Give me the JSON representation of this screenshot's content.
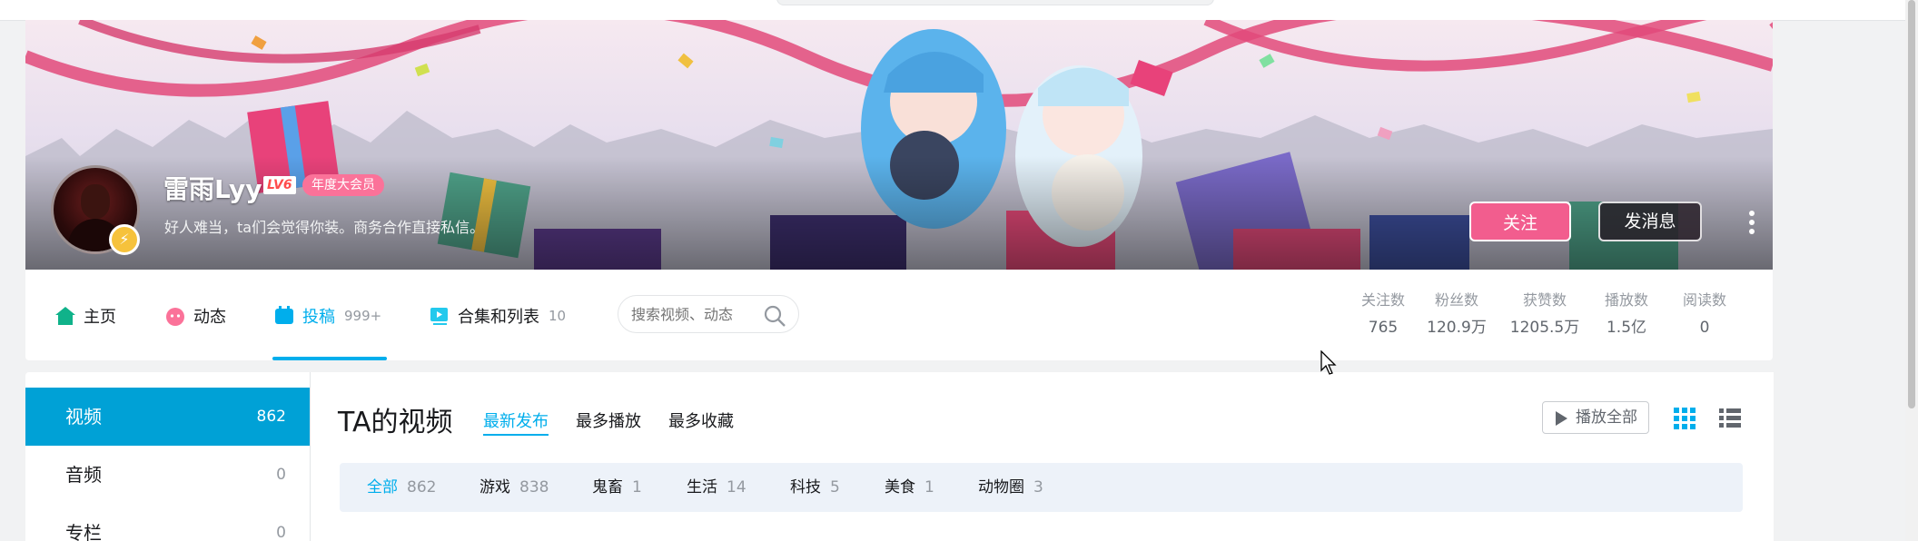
{
  "banner": {
    "user_name": "雷雨Lyy",
    "level_badge": "LV6",
    "vip_badge": "年度大会员",
    "bio": "好人难当，ta们会觉得你装。商务合作直接私信。",
    "follow_button": "关注",
    "message_button": "发消息"
  },
  "nav": {
    "tabs": [
      {
        "label": "主页",
        "count": "",
        "icon": "home-icon"
      },
      {
        "label": "动态",
        "count": "",
        "icon": "dynamic-icon"
      },
      {
        "label": "投稿",
        "count": "999+",
        "icon": "upload-icon"
      },
      {
        "label": "合集和列表",
        "count": "10",
        "icon": "collection-icon"
      }
    ],
    "active_tab": "投稿",
    "search_placeholder": "搜索视频、动态",
    "stats": [
      {
        "key": "关注数",
        "value": "765"
      },
      {
        "key": "粉丝数",
        "value": "120.9万"
      },
      {
        "key": "获赞数",
        "value": "1205.5万"
      },
      {
        "key": "播放数",
        "value": "1.5亿"
      },
      {
        "key": "阅读数",
        "value": "0"
      }
    ]
  },
  "sidebar": {
    "items": [
      {
        "label": "视频",
        "count": "862"
      },
      {
        "label": "音频",
        "count": "0"
      },
      {
        "label": "专栏",
        "count": "0"
      }
    ]
  },
  "main": {
    "title": "TA的视频",
    "sort_tabs": [
      "最新发布",
      "最多播放",
      "最多收藏"
    ],
    "play_all": "播放全部",
    "filters": [
      {
        "name": "全部",
        "count": "862"
      },
      {
        "name": "游戏",
        "count": "838"
      },
      {
        "name": "鬼畜",
        "count": "1"
      },
      {
        "name": "生活",
        "count": "14"
      },
      {
        "name": "科技",
        "count": "5"
      },
      {
        "name": "美食",
        "count": "1"
      },
      {
        "name": "动物圈",
        "count": "3"
      }
    ]
  },
  "colors": {
    "accent": "#00aeec",
    "sidebar_active": "#00a1d6",
    "follow": "#f25d8e",
    "vip": "#fb7299"
  }
}
